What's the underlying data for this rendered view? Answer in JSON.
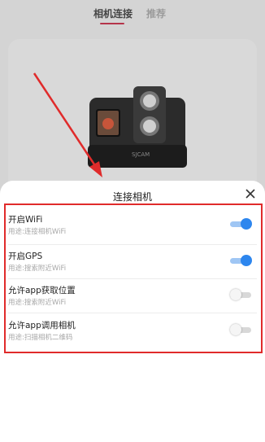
{
  "tabs": [
    {
      "label": "相机连接",
      "active": true
    },
    {
      "label": "推荐",
      "active": false
    }
  ],
  "camera": {
    "brand": "SJCAM"
  },
  "dialog": {
    "title": "连接相机",
    "close_icon": "close-icon",
    "permissions": [
      {
        "label": "开启WiFi",
        "desc": "用途:连接相机WiFi",
        "enabled": true
      },
      {
        "label": "开启GPS",
        "desc": "用途:搜索附近WiFi",
        "enabled": true
      },
      {
        "label": "允许app获取位置",
        "desc": "用途:搜索附近WiFi",
        "enabled": false
      },
      {
        "label": "允许app调用相机",
        "desc": "用途:扫描相机二维码",
        "enabled": false
      }
    ]
  },
  "colors": {
    "accent_red": "#e02b2b",
    "toggle_on": "#2d86ee",
    "tab_underline": "#b5344a"
  }
}
